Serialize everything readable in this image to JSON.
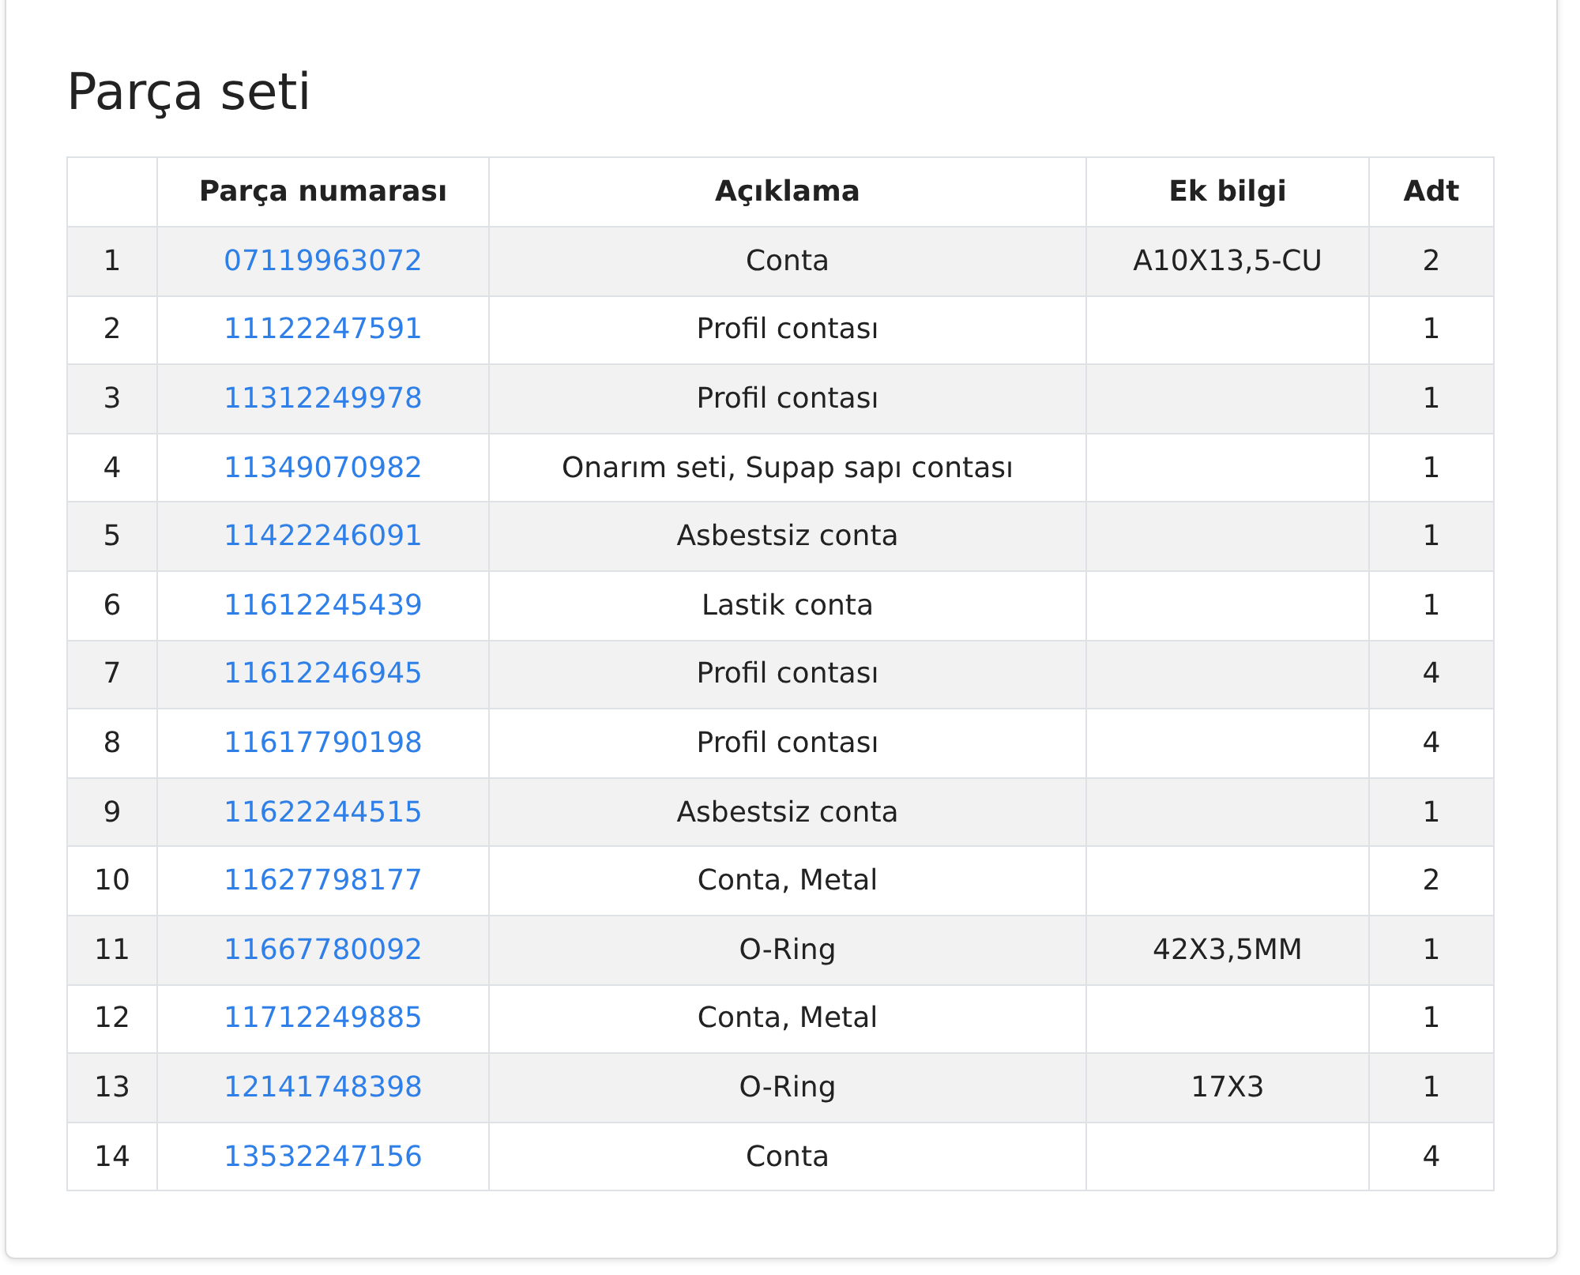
{
  "title": "Parça seti",
  "table": {
    "columns": [
      "",
      "Parça numarası",
      "Açıklama",
      "Ek bilgi",
      "Adt"
    ],
    "rows": [
      {
        "index": "1",
        "part_number": "07119963072",
        "description": "Conta",
        "extra": "A10X13,5-CU",
        "qty": "2"
      },
      {
        "index": "2",
        "part_number": "11122247591",
        "description": "Profil contası",
        "extra": "",
        "qty": "1"
      },
      {
        "index": "3",
        "part_number": "11312249978",
        "description": "Profil contası",
        "extra": "",
        "qty": "1"
      },
      {
        "index": "4",
        "part_number": "11349070982",
        "description": "Onarım seti, Supap sapı contası",
        "extra": "",
        "qty": "1"
      },
      {
        "index": "5",
        "part_number": "11422246091",
        "description": "Asbestsiz conta",
        "extra": "",
        "qty": "1"
      },
      {
        "index": "6",
        "part_number": "11612245439",
        "description": "Lastik conta",
        "extra": "",
        "qty": "1"
      },
      {
        "index": "7",
        "part_number": "11612246945",
        "description": "Profil contası",
        "extra": "",
        "qty": "4"
      },
      {
        "index": "8",
        "part_number": "11617790198",
        "description": "Profil contası",
        "extra": "",
        "qty": "4"
      },
      {
        "index": "9",
        "part_number": "11622244515",
        "description": "Asbestsiz conta",
        "extra": "",
        "qty": "1"
      },
      {
        "index": "10",
        "part_number": "11627798177",
        "description": "Conta, Metal",
        "extra": "",
        "qty": "2"
      },
      {
        "index": "11",
        "part_number": "11667780092",
        "description": "O-Ring",
        "extra": "42X3,5MM",
        "qty": "1"
      },
      {
        "index": "12",
        "part_number": "11712249885",
        "description": "Conta, Metal",
        "extra": "",
        "qty": "1"
      },
      {
        "index": "13",
        "part_number": "12141748398",
        "description": "O-Ring",
        "extra": "17X3",
        "qty": "1"
      },
      {
        "index": "14",
        "part_number": "13532247156",
        "description": "Conta",
        "extra": "",
        "qty": "4"
      }
    ]
  }
}
